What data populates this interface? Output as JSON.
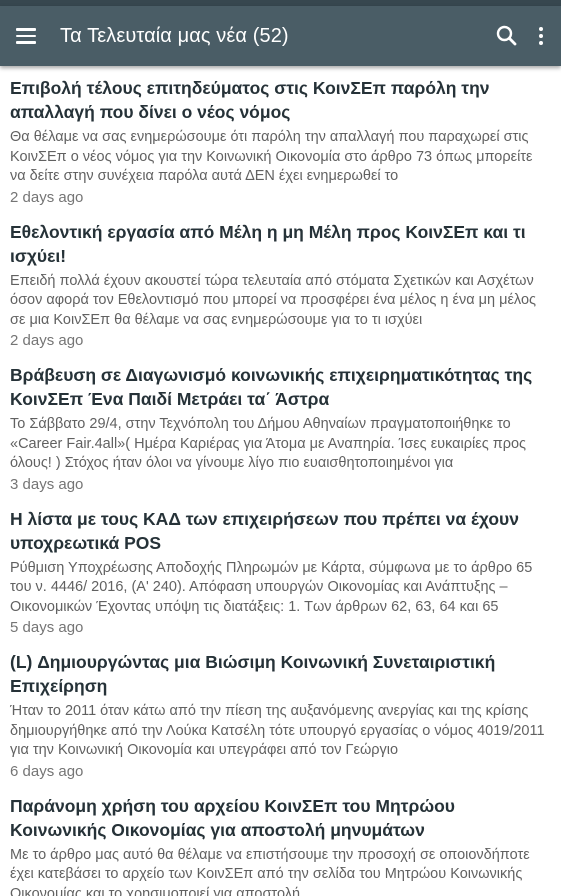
{
  "header": {
    "title": "Τα Τελευταία μας νέα (52)"
  },
  "articles": [
    {
      "title": "Επιβολή τέλους επιτηδεύματος στις ΚοινΣΕπ παρόλη την απαλλαγή που δίνει ο νέος νόμος",
      "excerpt": "Θα θέλαμε να σας ενημερώσουμε ότι παρόλη την απαλλαγή που παραχωρεί στις ΚοινΣΕπ ο νέος νόμος για την Κοινωνική Οικονομία στο άρθρο 73 όπως μπορείτε να δείτε στην συνέχεια παρόλα αυτά ΔΕΝ έχει ενημερωθεί το",
      "time": "2 days ago"
    },
    {
      "title": "Εθελοντική εργασία από Μέλη η μη Μέλη προς ΚοινΣΕπ και τι ισχύει!",
      "excerpt": "Επειδή πολλά έχουν ακουστεί τώρα τελευταία από στόματα Σχετικών και Ασχέτων όσον αφορά τον Εθελοντισμό που μπορεί να προσφέρει ένα μέλος η ένα μη μέλος σε μια ΚοινΣΕπ θα θέλαμε να σας ενημερώσουμε για το τι ισχύει",
      "time": "2 days ago"
    },
    {
      "title": "Βράβευση σε Διαγωνισμό κοινωνικής επιχειρηματικότητας της ΚοινΣΕπ Ένα Παιδί Μετράει τα΄ Άστρα",
      "excerpt": "Το Σάββατο 29/4, στην Τεχνόπολη του Δήμου Αθηναίων πραγματοποιήθηκε το «Career Fair.4all»( Ημέρα Καριέρας για Άτομα με Αναπηρία. Ίσες ευκαιρίες προς όλους! ) Στόχος ήταν όλοι να γίνουμε λίγο πιο ευαισθητοποιημένοι για",
      "time": "3 days ago"
    },
    {
      "title": "Η λίστα με τους ΚΑΔ των επιχειρήσεων που πρέπει να έχουν υποχρεωτικά POS",
      "excerpt": "Ρύθμιση Υποχρέωσης Αποδοχής Πληρωμών με Κάρτα, σύμφωνα με το άρθρο 65 του ν. 4446/ 2016, (Α' 240). Απόφαση υπουργών Οικονομίας και Ανάπτυξης – Οικονομικών Έχοντας υπόψη τις διατάξεις: 1. Των άρθρων 62, 63, 64 και 65",
      "time": "5 days ago"
    },
    {
      "title": "(L) Δημιουργώντας μια Βιώσιμη Κοινωνική Συνεταιριστική Επιχείρηση",
      "excerpt": "Ήταν το 2011 όταν κάτω από την πίεση της αυξανόμενης ανεργίας και της κρίσης δημιουργήθηκε από την Λούκα Κατσέλη τότε υπουργό εργασίας ο νόμος 4019/2011 για την Κοινωνική Οικονομία και υπεγράφει από τον Γεώργιο",
      "time": "6 days ago"
    },
    {
      "title": "Παράνομη χρήση του αρχείου ΚοινΣΕπ του Μητρώου Κοινωνικής Οικονομίας για αποστολή μηνυμάτων",
      "excerpt": "Με το άρθρο μας αυτό θα θέλαμε να επιστήσουμε την προσοχή σε οποιονδήποτε έχει κατεβάσει το αρχείο των ΚοινΣΕπ από την σελίδα του Μητρώου Κοινωνικής Οικονομίας και το χρησιμοποιεί για αποστολή",
      "time": ""
    }
  ]
}
